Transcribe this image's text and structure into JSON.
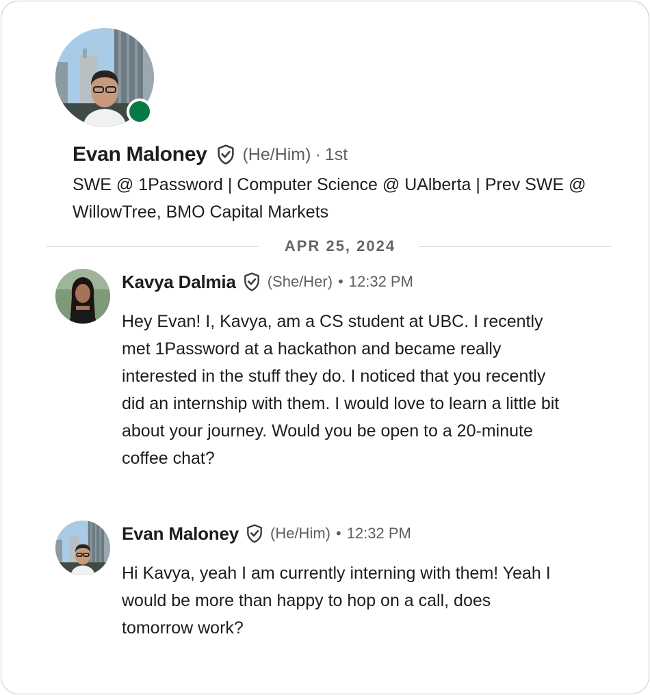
{
  "profile": {
    "name": "Evan Maloney",
    "pronouns": "(He/Him)",
    "separator": "·",
    "degree": "1st",
    "headline": "SWE @ 1Password | Computer Science @ UAlberta | Prev SWE @ WillowTree, BMO Capital Markets",
    "presence_color": "#067a46",
    "verified_icon": "verified-shield-icon"
  },
  "date_divider": "APR 25, 2024",
  "messages": [
    {
      "sender": "Kavya Dalmia",
      "pronouns": "(She/Her)",
      "separator": "•",
      "time": "12:32 PM",
      "body": "Hey Evan! I, Kavya, am a CS student at UBC. I recently met 1Password at a hackathon and became really interested in the stuff they do. I noticed that you recently did an internship with them. I would love to learn a little bit about your journey. Would you be open to a 20-minute coffee chat?"
    },
    {
      "sender": "Evan Maloney",
      "pronouns": "(He/Him)",
      "separator": "•",
      "time": "12:32 PM",
      "body": "Hi Kavya, yeah I am currently interning with them! Yeah I would be more than happy to hop on a call, does tomorrow work?"
    }
  ]
}
